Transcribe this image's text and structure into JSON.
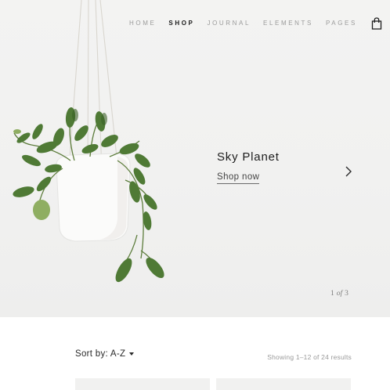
{
  "nav": {
    "items": [
      {
        "label": "HOME",
        "active": false
      },
      {
        "label": "SHOP",
        "active": true
      },
      {
        "label": "JOURNAL",
        "active": false
      },
      {
        "label": "ELEMENTS",
        "active": false
      },
      {
        "label": "PAGES",
        "active": false
      }
    ],
    "cart_icon": "shopping-bag-icon"
  },
  "hero": {
    "title": "Sky Planet",
    "cta_label": "Shop now",
    "next_icon": "chevron-right-icon",
    "pager": {
      "current": "1",
      "of_label": "of",
      "total": "3"
    }
  },
  "toolbar": {
    "left_fragment": "s",
    "sort_label": "Sort by: A-Z",
    "results_text": "Showing 1–12 of 24 results"
  },
  "colors": {
    "hero_background": "#f1f1f0",
    "text_dark": "#1c1c1c",
    "nav_inactive": "#9b9b9b",
    "leaf_green": "#4f7a35"
  }
}
